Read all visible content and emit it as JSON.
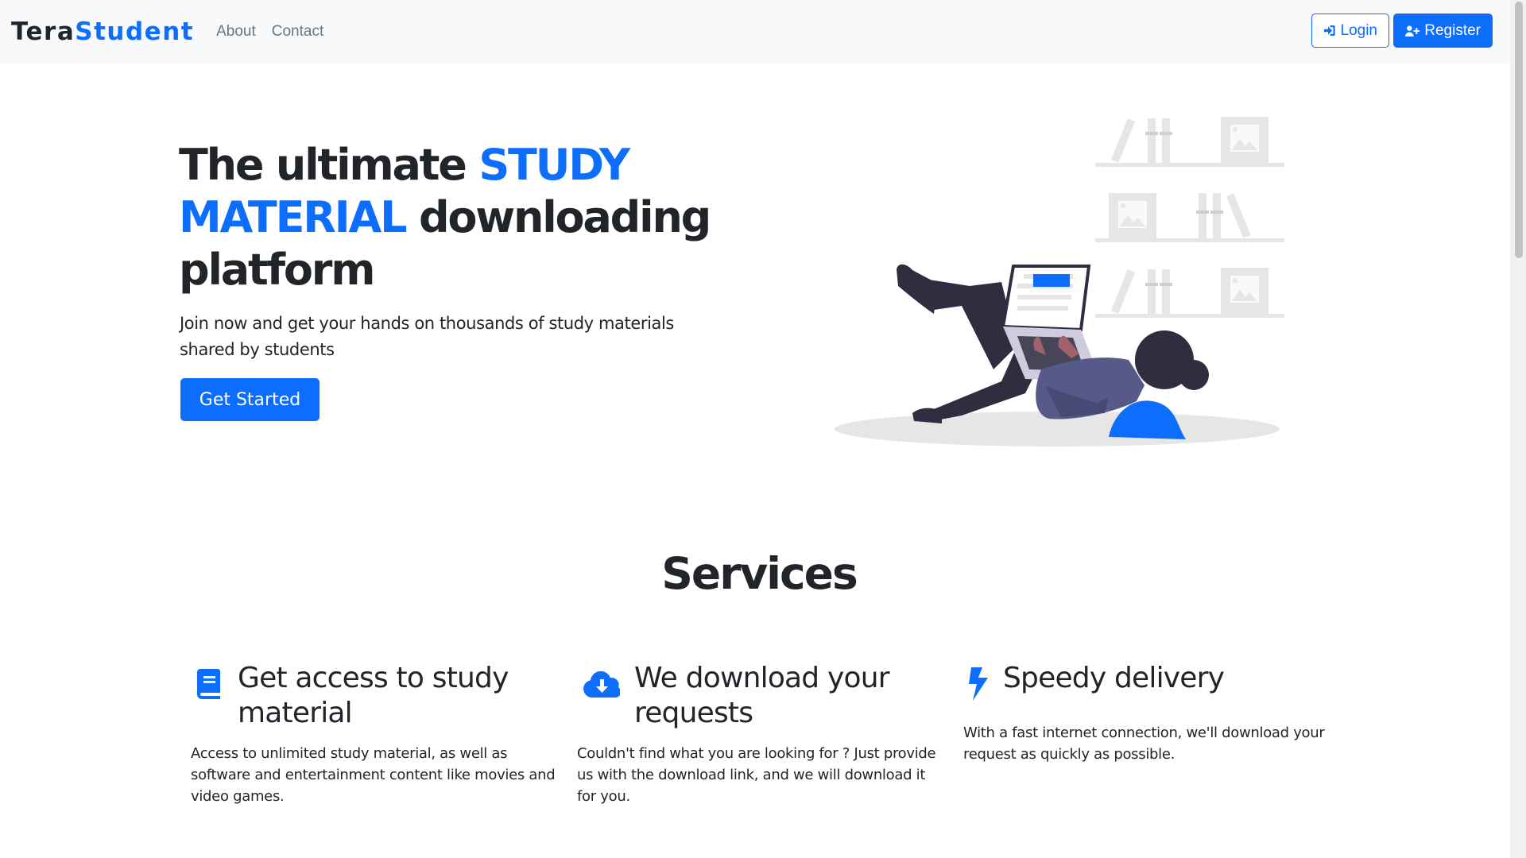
{
  "nav": {
    "brand_part1": "Tera",
    "brand_part2": "Student",
    "links": [
      "About",
      "Contact"
    ],
    "login_label": "Login",
    "register_label": "Register"
  },
  "hero": {
    "title_part1": "The ultimate ",
    "title_highlight": "STUDY MATERIAL",
    "title_part2": " downloading platform",
    "subtitle": "Join now and get your hands on thousands of study materials shared by students",
    "cta_label": "Get Started"
  },
  "services": {
    "title": "Services",
    "items": [
      {
        "icon": "book-icon",
        "heading": "Get access to study material",
        "text": "Access to unlimited study material, as well as software and entertainment content like movies and video games."
      },
      {
        "icon": "cloud-download-icon",
        "heading": "We download your requests",
        "text": "Couldn't find what you are looking for ? Just provide us with the download link, and we will download it for you."
      },
      {
        "icon": "bolt-icon",
        "heading": "Speedy delivery",
        "text": "With a fast internet connection, we'll download your request as quickly as possible."
      }
    ]
  },
  "colors": {
    "primary": "#0d6efd",
    "navbar_bg": "#f8f9fa",
    "text": "#212529",
    "nav_link": "#6c757d"
  }
}
